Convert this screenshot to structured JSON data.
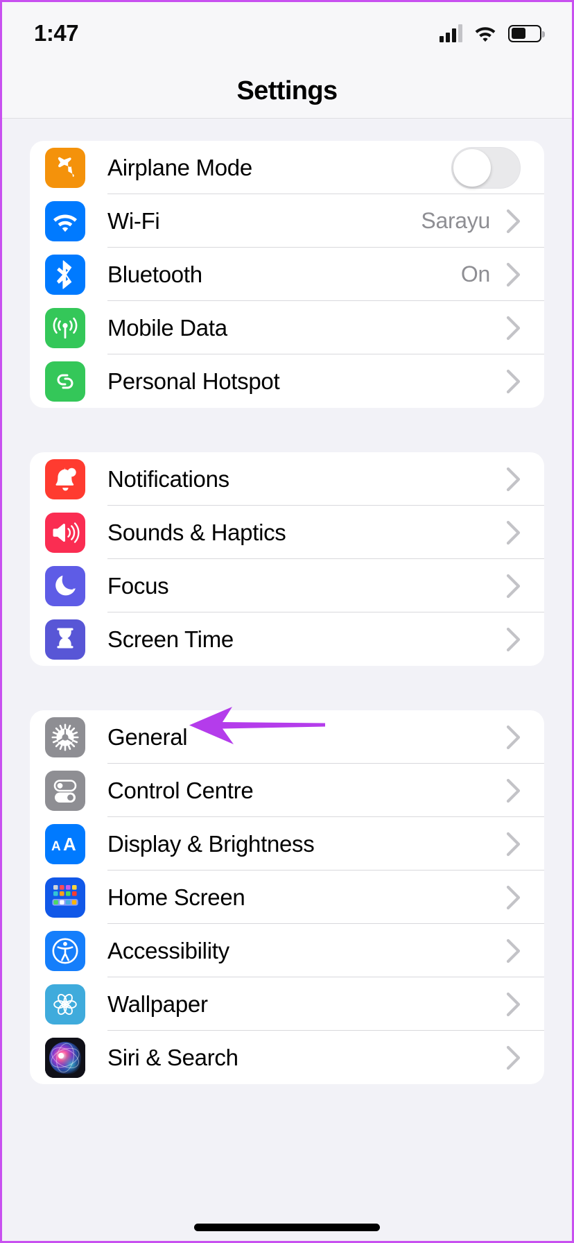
{
  "status_bar": {
    "time": "1:47",
    "cellular_icon": "cellular-signal-icon",
    "wifi_icon": "wifi-icon",
    "battery_icon": "battery-icon"
  },
  "nav": {
    "title": "Settings"
  },
  "annotation": {
    "type": "arrow-left",
    "color": "#b43ceb",
    "points_to": "General"
  },
  "colors": {
    "background": "#f2f2f7",
    "card": "#ffffff",
    "separator": "#d8d8dc",
    "secondary_text": "#8e8e93",
    "border": "#c850f0"
  },
  "groups": [
    {
      "name": "connectivity",
      "rows": [
        {
          "label": "Airplane Mode",
          "icon": "airplane-icon",
          "icon_color": "#f4920b",
          "accessory": "toggle",
          "toggle_on": false
        },
        {
          "label": "Wi-Fi",
          "icon": "wifi-icon",
          "icon_color": "#007aff",
          "accessory": "chevron",
          "value": "Sarayu"
        },
        {
          "label": "Bluetooth",
          "icon": "bluetooth-icon",
          "icon_color": "#007aff",
          "accessory": "chevron",
          "value": "On"
        },
        {
          "label": "Mobile Data",
          "icon": "cellular-antenna-icon",
          "icon_color": "#34c759",
          "accessory": "chevron",
          "value": ""
        },
        {
          "label": "Personal Hotspot",
          "icon": "hotspot-link-icon",
          "icon_color": "#34c759",
          "accessory": "chevron",
          "value": ""
        }
      ]
    },
    {
      "name": "alerts",
      "rows": [
        {
          "label": "Notifications",
          "icon": "bell-icon",
          "icon_color": "#ff3b30",
          "accessory": "chevron",
          "value": ""
        },
        {
          "label": "Sounds & Haptics",
          "icon": "speaker-icon",
          "icon_color": "#fa2d52",
          "accessory": "chevron",
          "value": ""
        },
        {
          "label": "Focus",
          "icon": "moon-icon",
          "icon_color": "#5e5ce6",
          "accessory": "chevron",
          "value": ""
        },
        {
          "label": "Screen Time",
          "icon": "hourglass-icon",
          "icon_color": "#5856d6",
          "accessory": "chevron",
          "value": ""
        }
      ]
    },
    {
      "name": "system",
      "rows": [
        {
          "label": "General",
          "icon": "gear-icon",
          "icon_color": "#8e8e93",
          "accessory": "chevron",
          "value": ""
        },
        {
          "label": "Control Centre",
          "icon": "control-centre-toggles-icon",
          "icon_color": "#8e8e93",
          "accessory": "chevron",
          "value": ""
        },
        {
          "label": "Display & Brightness",
          "icon": "display-aa-icon",
          "icon_color": "#007aff",
          "accessory": "chevron",
          "value": ""
        },
        {
          "label": "Home Screen",
          "icon": "home-screen-grid-icon",
          "icon_color": "#1158e8",
          "accessory": "chevron",
          "value": ""
        },
        {
          "label": "Accessibility",
          "icon": "accessibility-icon",
          "icon_color": "#157efb",
          "accessory": "chevron",
          "value": ""
        },
        {
          "label": "Wallpaper",
          "icon": "wallpaper-flower-icon",
          "icon_color": "#3fabdc",
          "accessory": "chevron",
          "value": ""
        },
        {
          "label": "Siri & Search",
          "icon": "siri-orb-icon",
          "icon_color": "#1a1a24",
          "accessory": "chevron",
          "value": ""
        }
      ]
    }
  ]
}
